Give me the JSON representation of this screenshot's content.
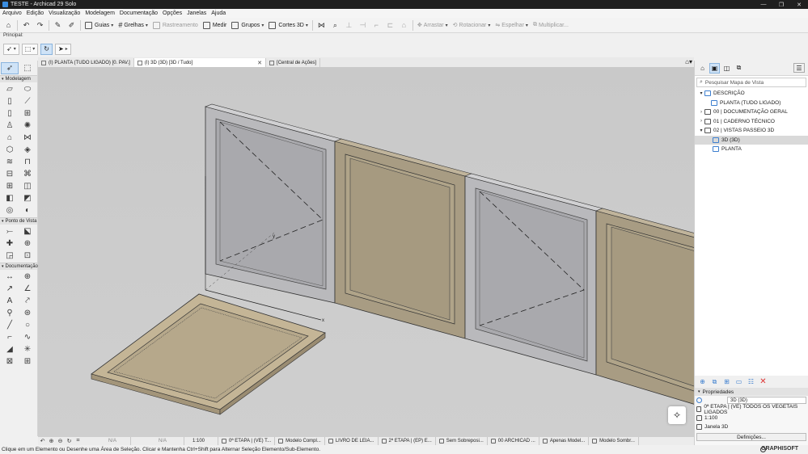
{
  "window": {
    "title": "TESTE - Archicad 29 Solo",
    "minimize": "—",
    "restore": "❐",
    "close": "✕"
  },
  "menu": [
    "Arquivo",
    "Edição",
    "Visualização",
    "Modelagem",
    "Documentação",
    "Opções",
    "Janelas",
    "Ajuda"
  ],
  "toolbar": {
    "guias": "Guias",
    "grelhas": "Grelhas",
    "rastreamento": "Rastreamento",
    "medir": "Medir",
    "grupos": "Grupos",
    "cortes3d": "Cortes 3D",
    "arrastar": "Arrastar",
    "rotacionar": "Rotacionar",
    "espelhar": "Espelhar",
    "multiplicar": "Multiplicar..."
  },
  "infobox": {
    "label": "Principal:"
  },
  "tabs": [
    {
      "label": "(I) PLANTA (TUDO LIGADO) [0. PAV.]",
      "active": false
    },
    {
      "label": "(I) 3D (3D) [3D / Tudo]",
      "active": true
    },
    {
      "label": "[Central de Ações]",
      "active": false
    }
  ],
  "toolbox": {
    "sections": [
      "Modelagem",
      "Ponto de Vista",
      "Documentação"
    ]
  },
  "viewport": {
    "axis_x": "x",
    "axis_y": "y",
    "colors": {
      "background": "#cbcbcb",
      "glass_frame": "#b8b8bb",
      "glass": "#a9a9ad",
      "wood": "#a89c83",
      "wood_light": "#c4b596"
    }
  },
  "statusbar": {
    "items": [
      {
        "label": "N/A",
        "na": true
      },
      {
        "label": "N/A",
        "na": true
      },
      {
        "label": "1:100"
      },
      {
        "label": "0ª ETAPA | (VE) T..."
      },
      {
        "label": "Modelo Compl..."
      },
      {
        "label": "LIVRO DE LEIA..."
      },
      {
        "label": "2ª ETAPA | (EP) E..."
      },
      {
        "label": "Sem Sobreposi..."
      },
      {
        "label": "00 ARCHICAD ..."
      },
      {
        "label": "Apenas Model..."
      },
      {
        "label": "Modelo Sombr..."
      }
    ]
  },
  "footer": {
    "message": "Clique em um Elemento ou Desenhe uma Área de Seleção. Clicar e Mantenha Ctrl+Shift para Alternar Seleção Elemento/Sub-Elemento.",
    "brand": "GRAPHISOFT"
  },
  "navigator": {
    "search_placeholder": "Pesquisar Mapa de Vista",
    "tree": [
      {
        "label": "DESCRIÇÃO",
        "level": 0,
        "exp": "▾",
        "type": "root"
      },
      {
        "label": "PLANTA (TUDO LIGADO)",
        "level": 1,
        "exp": "",
        "type": "view"
      },
      {
        "label": "00 | DOCUMENTAÇÃO GERAL",
        "level": 1,
        "exp": "›",
        "type": "folder"
      },
      {
        "label": "01 | CADERNO TÉCNICO",
        "level": 1,
        "exp": "›",
        "type": "folder"
      },
      {
        "label": "02 | VISTAS PASSEIO 3D",
        "level": 1,
        "exp": "▾",
        "type": "folder"
      },
      {
        "label": "3D (3D)",
        "level": 2,
        "exp": "",
        "type": "view",
        "selected": true
      },
      {
        "label": "PLANTA",
        "level": 2,
        "exp": "",
        "type": "view"
      }
    ]
  },
  "properties": {
    "header": "Propriedades",
    "view_name": "3D (3D)",
    "layer_combo": "0ª ETAPA | (VE) TODOS OS VEGETAIS LIGADOS",
    "scale": "1:100",
    "window": "Janela 3D",
    "settings_button": "Definições..."
  }
}
